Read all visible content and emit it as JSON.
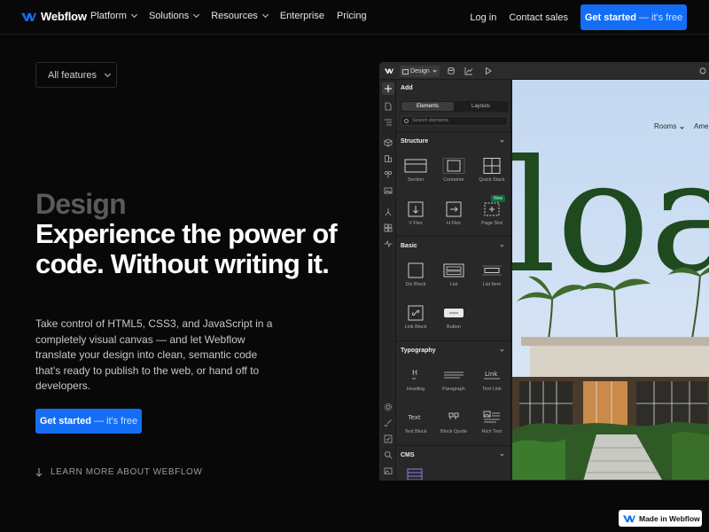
{
  "nav": {
    "brand": "Webflow",
    "links": [
      {
        "label": "Platform",
        "has_menu": true
      },
      {
        "label": "Solutions",
        "has_menu": true
      },
      {
        "label": "Resources",
        "has_menu": true
      },
      {
        "label": "Enterprise",
        "has_menu": false
      },
      {
        "label": "Pricing",
        "has_menu": false
      }
    ],
    "login": "Log in",
    "contact": "Contact sales",
    "cta_strong": "Get started",
    "cta_light": "— it's free"
  },
  "features_dropdown": "All features",
  "hero": {
    "eyebrow": "Design",
    "title": "Experience the power of code. Without writing it.",
    "description": "Take control of HTML5, CSS3, and JavaScript in a completely visual canvas — and let Webflow translate your design into clean, semantic code that's ready to publish to the web, or hand off to developers.",
    "cta_strong": "Get started",
    "cta_light": "— it's free",
    "learn_more": "LEARN MORE ABOUT WEBFLOW"
  },
  "designer": {
    "mode_button": "Design",
    "panel_title": "Add",
    "tabs": [
      "Elements",
      "Layouts"
    ],
    "search_placeholder": "Search elements",
    "sections": [
      {
        "title": "Structure",
        "items": [
          "Section",
          "Container",
          "Quick Stack",
          "V Flex",
          "H Flex",
          "Page Slot"
        ]
      },
      {
        "title": "Basic",
        "items": [
          "Div Block",
          "List",
          "List Item",
          "Link Block",
          "Button"
        ]
      },
      {
        "title": "Typography",
        "items": [
          "Heading",
          "Paragraph",
          "Text Link",
          "Text Block",
          "Block Quote",
          "Rich Text"
        ]
      },
      {
        "title": "CMS",
        "items": []
      }
    ],
    "new_badge": "New",
    "canvas": {
      "nav_rooms": "Rooms",
      "nav_amenities": "Amen",
      "display_text": "loa"
    }
  },
  "badge": "Made in Webflow",
  "colors": {
    "accent": "#146ef5",
    "background": "#080808",
    "canvas_green": "#1f4a1f"
  }
}
